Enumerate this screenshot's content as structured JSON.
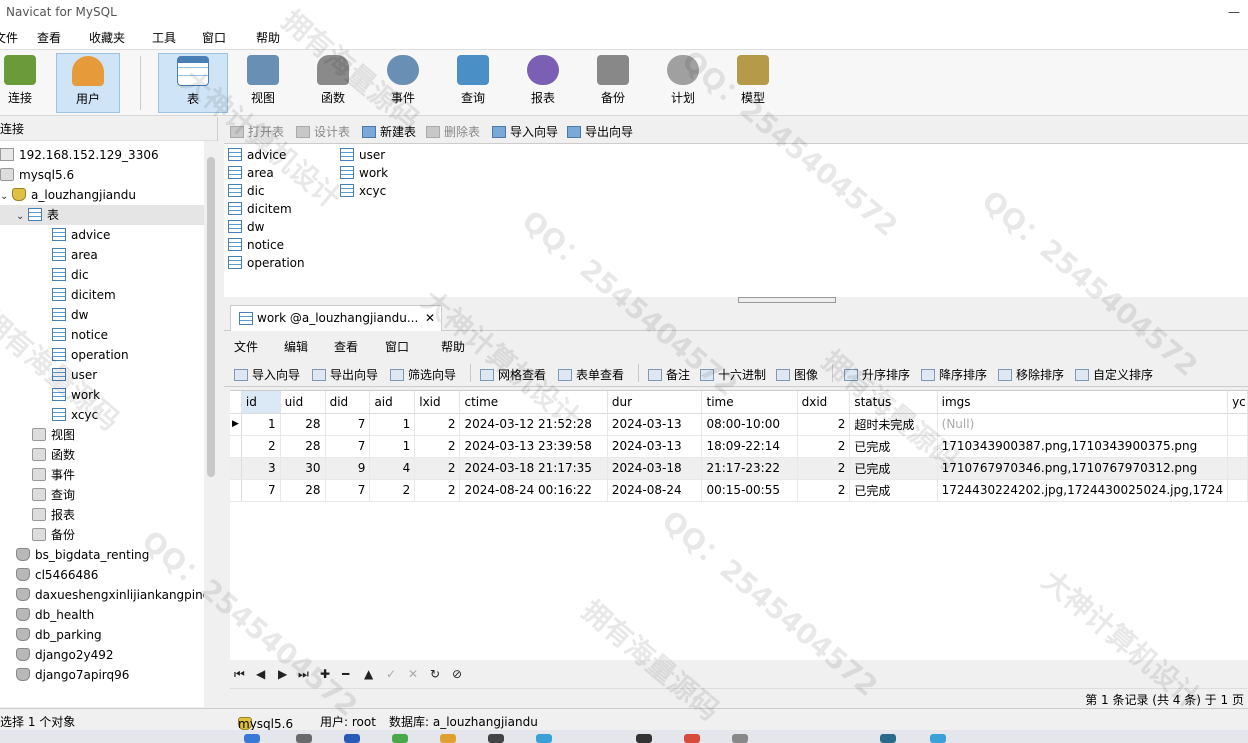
{
  "window": {
    "title": "Navicat for MySQL"
  },
  "menu": [
    "文件",
    "查看",
    "收藏夹",
    "工具",
    "窗口",
    "帮助"
  ],
  "toolbar": [
    {
      "label": "连接",
      "icon": "plug-icon",
      "color": "#6a9a3a"
    },
    {
      "label": "用户",
      "icon": "user-icon",
      "color": "#e79a3a"
    },
    {
      "label": "表",
      "icon": "table-icon",
      "color": "#4a7fb5"
    },
    {
      "label": "视图",
      "icon": "view-icon",
      "color": "#6a8fb5"
    },
    {
      "label": "函数",
      "icon": "function-icon",
      "color": "#8a8a8a"
    },
    {
      "label": "事件",
      "icon": "event-icon",
      "color": "#6a8fb5"
    },
    {
      "label": "查询",
      "icon": "query-icon",
      "color": "#4a8fc5"
    },
    {
      "label": "报表",
      "icon": "report-icon",
      "color": "#7a5fb5"
    },
    {
      "label": "备份",
      "icon": "backup-icon",
      "color": "#888888"
    },
    {
      "label": "计划",
      "icon": "schedule-icon",
      "color": "#a0a0a0"
    },
    {
      "label": "模型",
      "icon": "model-icon",
      "color": "#b59a4a"
    }
  ],
  "left_pane": {
    "header": "连接",
    "connection": "192.168.152.129_3306",
    "server": "mysql5.6",
    "database": "a_louzhangjiandu",
    "tables_node": "表",
    "tables": [
      "advice",
      "area",
      "dic",
      "dicitem",
      "dw",
      "notice",
      "operation",
      "user",
      "work",
      "xcyc"
    ],
    "other_nodes": [
      "视图",
      "函数",
      "事件",
      "查询",
      "报表",
      "备份"
    ],
    "other_databases": [
      "bs_bigdata_renting",
      "cl5466486",
      "daxueshengxinlijiankangping",
      "db_health",
      "db_parking",
      "django2y492",
      "django7apirq96"
    ]
  },
  "object_toolbar": [
    "打开表",
    "设计表",
    "新建表",
    "删除表",
    "导入向导",
    "导出向导"
  ],
  "object_list": {
    "col1": [
      "advice",
      "area",
      "dic",
      "dicitem",
      "dw",
      "notice",
      "operation"
    ],
    "col2": [
      "user",
      "work",
      "xcyc"
    ]
  },
  "tab": {
    "label": "work @a_louzhangjiandu...",
    "close": "✕"
  },
  "inner_menu": [
    "文件",
    "编辑",
    "查看",
    "窗口",
    "帮助"
  ],
  "inner_toolbar": [
    "导入向导",
    "导出向导",
    "筛选向导",
    "网格查看",
    "表单查看",
    "备注",
    "十六进制",
    "图像",
    "升序排序",
    "降序排序",
    "移除排序",
    "自定义排序"
  ],
  "grid": {
    "columns": [
      "id",
      "uid",
      "did",
      "aid",
      "lxid",
      "ctime",
      "dur",
      "time",
      "dxid",
      "status",
      "imgs",
      "yc"
    ],
    "rows": [
      [
        "1",
        "28",
        "7",
        "1",
        "2",
        "2024-03-12 21:52:28",
        "2024-03-13",
        "08:00-10:00",
        "2",
        "超时未完成",
        "(Null)",
        ""
      ],
      [
        "2",
        "28",
        "7",
        "1",
        "2",
        "2024-03-13 23:39:58",
        "2024-03-13",
        "18:09-22:14",
        "2",
        "已完成",
        "1710343900387.png,1710343900375.png",
        ""
      ],
      [
        "3",
        "30",
        "9",
        "4",
        "2",
        "2024-03-18 21:17:35",
        "2024-03-18",
        "21:17-23:22",
        "2",
        "已完成",
        "1710767970346.png,1710767970312.png",
        ""
      ],
      [
        "7",
        "28",
        "7",
        "2",
        "2",
        "2024-08-24 00:16:22",
        "2024-08-24",
        "00:15-00:55",
        "2",
        "已完成",
        "1724430224202.jpg,1724430025024.jpg,1724",
        ""
      ]
    ],
    "current_row_marker": "▶"
  },
  "nav": [
    "⏮",
    "◀",
    "▶",
    "⏭",
    "✚",
    "━",
    "▲",
    "✓",
    "✕",
    "↻",
    "⊘"
  ],
  "record_info": "第 1 条记录 (共 4 条) 于 1 页",
  "status": {
    "selected": "选择 1 个对象",
    "server": "mysql5.6",
    "user": "用户: root",
    "database": "数据库: a_louzhangjiandu"
  },
  "watermarks": [
    "拥有海量源码",
    "QQ：2545404572",
    "大神计算机设计"
  ]
}
